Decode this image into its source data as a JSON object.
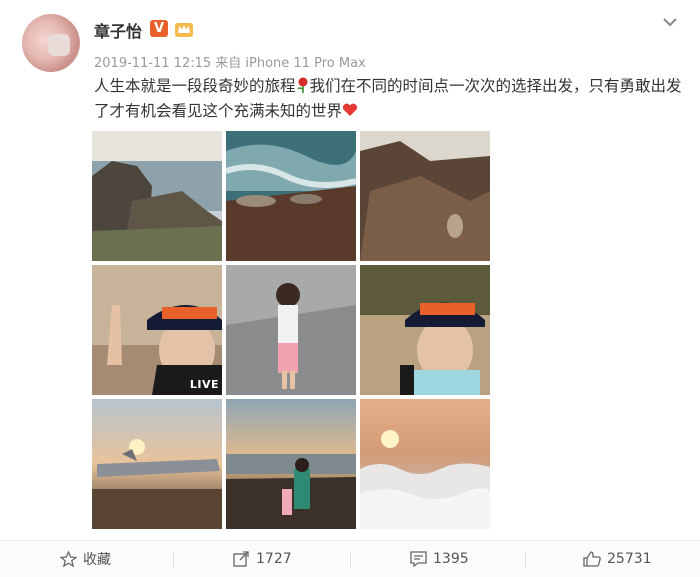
{
  "post": {
    "author": "章子怡",
    "meta": "2019-11-11 12:15 来自 iPhone 11 Pro Max",
    "text_part1": "人生本就是一段段奇妙的旅程",
    "text_part2": "我们在不同的时间点一次次的选择出发，只有勇敢出发了才有机会看见这个充满未知的世界",
    "badge_v": "V",
    "live_label": "LIVE"
  },
  "photos": [
    {
      "name": "photo-rocks-sea"
    },
    {
      "name": "photo-sea-lions"
    },
    {
      "name": "photo-rock-shore"
    },
    {
      "name": "photo-selfie-pointing"
    },
    {
      "name": "photo-child-street"
    },
    {
      "name": "photo-selfie-rocks"
    },
    {
      "name": "photo-jet-sunset"
    },
    {
      "name": "photo-beach-sunset"
    },
    {
      "name": "photo-clouds-sunset"
    }
  ],
  "actions": {
    "favorite_label": "收藏",
    "repost_count": "1727",
    "comment_count": "1395",
    "like_count": "25731"
  },
  "colors": {
    "accent": "#e8612b",
    "text": "#333333",
    "meta": "#999999"
  },
  "icons": [
    "chevron-down-icon",
    "verified-v-icon",
    "crown-badge-icon",
    "rose-emoji-icon",
    "heart-emoji-icon",
    "star-icon",
    "repost-icon",
    "comment-icon",
    "like-icon"
  ]
}
